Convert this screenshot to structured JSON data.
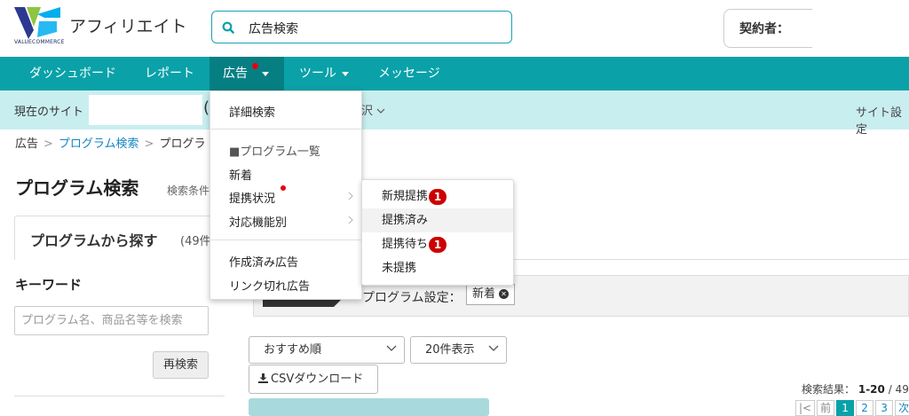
{
  "header": {
    "logo_text": "VALUECOMMERCE",
    "app_title": "アフィリエイト",
    "search": {
      "value": "広告検索"
    },
    "contract_label": "契約者："
  },
  "nav": {
    "items": [
      {
        "label": "ダッシュボード"
      },
      {
        "label": "レポート"
      },
      {
        "label": "広告"
      },
      {
        "label": "ツール"
      },
      {
        "label": "メッセージ"
      }
    ]
  },
  "subbar": {
    "current_site_label": "現在のサイト",
    "paren": "(",
    "select_label": "沢",
    "site_settings": "サイト設定"
  },
  "breadcrumb": [
    "広告",
    "プログラム検索",
    "プログラ"
  ],
  "page": {
    "title": "プログラム検索",
    "search_conditions": "検索条件"
  },
  "left_panel": {
    "tab_label": "プログラムから探す",
    "tab_count": "(49件",
    "keyword_label": "キーワード",
    "keyword_placeholder": "プログラム名、商品名等を検索",
    "research_button": "再検索"
  },
  "program_settings": {
    "label": "プログラム設定：",
    "chip": "新着",
    "chip_remove": "✕"
  },
  "controls": {
    "sort": "おすすめ順",
    "per_page": "20件表示",
    "csv_download": "CSVダウンロード"
  },
  "results": {
    "label": "検索結果：",
    "range": "1-20",
    "total": "/ 49"
  },
  "pager": [
    "|<",
    "前",
    "1",
    "2",
    "3",
    "次"
  ],
  "dropdown": {
    "items": [
      {
        "label": "詳細検索"
      },
      {
        "label": "■プログラム一覧"
      },
      {
        "label": "新着"
      },
      {
        "label": "提携状況"
      },
      {
        "label": "対応機能別"
      },
      {
        "label": "作成済み広告"
      },
      {
        "label": "リンク切れ広告"
      }
    ]
  },
  "submenu": {
    "items": [
      {
        "label": "新規提携",
        "badge": "1"
      },
      {
        "label": "提携済み"
      },
      {
        "label": "提携待ち",
        "badge": "1"
      },
      {
        "label": "未提携"
      }
    ]
  },
  "colors": {
    "brand_teal": "#0aa1a8",
    "nav_active": "#067f83",
    "subbar_bg": "#c9eef0",
    "link_blue": "#1585c0",
    "badge_red": "#cc0000"
  }
}
